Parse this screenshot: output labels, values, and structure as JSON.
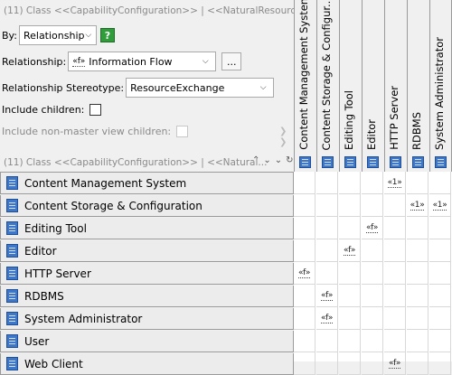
{
  "criteria": {
    "scope_label": "(11) Class <<CapabilityConfiguration>> | <<NaturalResource...",
    "by_label": "By:",
    "by_value": "Relationship",
    "help_glyph": "?",
    "relationship_label": "Relationship:",
    "relationship_value": "Information Flow",
    "relationship_tag": "«f»",
    "more_button": "...",
    "stereotype_label": "Relationship Stereotype:",
    "stereotype_value": "ResourceExchange",
    "include_children_label": "Include children:",
    "include_nonmaster_label": "Include non-master view children:"
  },
  "row_scope_label": "(11) Class <<CapabilityConfiguration>> | <<Natural...",
  "columns": [
    {
      "label": "Content Management System"
    },
    {
      "label": "Content Storage & Configur..."
    },
    {
      "label": "Editing Tool"
    },
    {
      "label": "Editor"
    },
    {
      "label": "HTTP Server"
    },
    {
      "label": "RDBMS"
    },
    {
      "label": "System Administrator"
    }
  ],
  "rows": [
    {
      "label": "Content Management System",
      "cells": [
        "",
        "",
        "",
        "",
        "«1»",
        "",
        ""
      ]
    },
    {
      "label": "Content Storage & Configuration",
      "cells": [
        "",
        "",
        "",
        "",
        "",
        "«1»",
        "«1»"
      ]
    },
    {
      "label": "Editing Tool",
      "cells": [
        "",
        "",
        "",
        "«f»",
        "",
        "",
        ""
      ]
    },
    {
      "label": "Editor",
      "cells": [
        "",
        "",
        "«f»",
        "",
        "",
        "",
        ""
      ]
    },
    {
      "label": "HTTP Server",
      "cells": [
        "«f»",
        "",
        "",
        "",
        "",
        "",
        ""
      ]
    },
    {
      "label": "RDBMS",
      "cells": [
        "",
        "«f»",
        "",
        "",
        "",
        "",
        ""
      ]
    },
    {
      "label": "System Administrator",
      "cells": [
        "",
        "«f»",
        "",
        "",
        "",
        "",
        ""
      ]
    },
    {
      "label": "User",
      "cells": [
        "",
        "",
        "",
        "",
        "",
        "",
        ""
      ]
    },
    {
      "label": "Web Client",
      "cells": [
        "",
        "",
        "",
        "",
        "«f»",
        "",
        ""
      ]
    }
  ],
  "icons": {
    "row_icon": "class-icon",
    "nav_up": "chevron-up-icon",
    "nav_down": "chevron-down-icon",
    "nav_right": "chevron-right-icon"
  },
  "colors": {
    "accent": "#3f76c6",
    "help": "#2e9d3a"
  }
}
